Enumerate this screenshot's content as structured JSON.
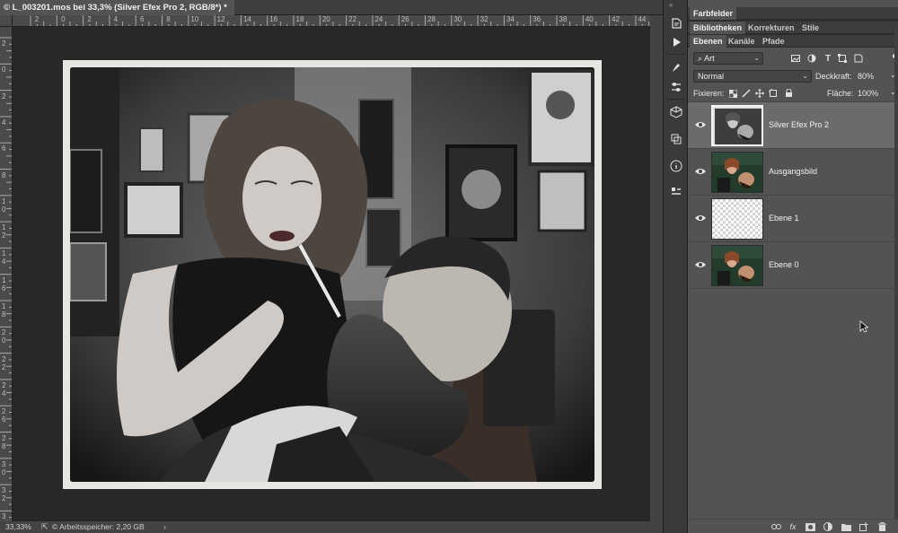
{
  "document": {
    "tab_title": "© L_003201.mos bei 33,3% (Silver Efex Pro 2, RGB/8*) *"
  },
  "rulers": {
    "horizontal_labels": [
      "2",
      "0",
      "2",
      "4",
      "6",
      "8",
      "10",
      "12",
      "14",
      "16",
      "18",
      "20",
      "22",
      "24",
      "26",
      "28",
      "30",
      "32",
      "34",
      "36",
      "38",
      "40",
      "42",
      "44"
    ],
    "vertical_labels": [
      "2",
      "0",
      "2",
      "4",
      "6",
      "8",
      "10",
      "12",
      "14",
      "16",
      "18",
      "20",
      "22",
      "24",
      "26",
      "28",
      "30",
      "32",
      "34"
    ]
  },
  "status_bar": {
    "zoom": "33,33%",
    "info": "© Arbeitsspeicher: 2,20 GB",
    "arrow": "›"
  },
  "tools": [
    "history-icon",
    "play-icon",
    "brush-settings-icon",
    "adjust-icon",
    "cube-3d-icon",
    "paths-icon",
    "info-icon",
    "properties-icon"
  ],
  "panel": {
    "top_tab": "Farbfelder",
    "second_tabs": [
      "Bibliotheken",
      "Korrekturen",
      "Stile"
    ],
    "layer_tabs": [
      "Ebenen",
      "Kanäle",
      "Pfade"
    ],
    "filter": {
      "label": "Art"
    },
    "blend_mode": "Normal",
    "opacity_label": "Deckkraft:",
    "opacity_value": "80%",
    "lock_label": "Fixieren:",
    "fill_label": "Fläche:",
    "fill_value": "100%",
    "layers": [
      {
        "name": "Silver Efex Pro 2",
        "selected": true,
        "type": "bw"
      },
      {
        "name": "Ausgangsbild",
        "selected": false,
        "type": "color"
      },
      {
        "name": "Ebene 1",
        "selected": false,
        "type": "transparent"
      },
      {
        "name": "Ebene 0",
        "selected": false,
        "type": "color"
      }
    ],
    "footer_icons": [
      "link-icon",
      "fx-icon",
      "mask-icon",
      "adjustment-layer-icon",
      "group-folder-icon",
      "new-layer-icon",
      "trash-icon"
    ]
  },
  "colors": {
    "panel_bg": "#535353",
    "selected_layer": "#6b6b6b",
    "canvas_bg": "#282828"
  }
}
